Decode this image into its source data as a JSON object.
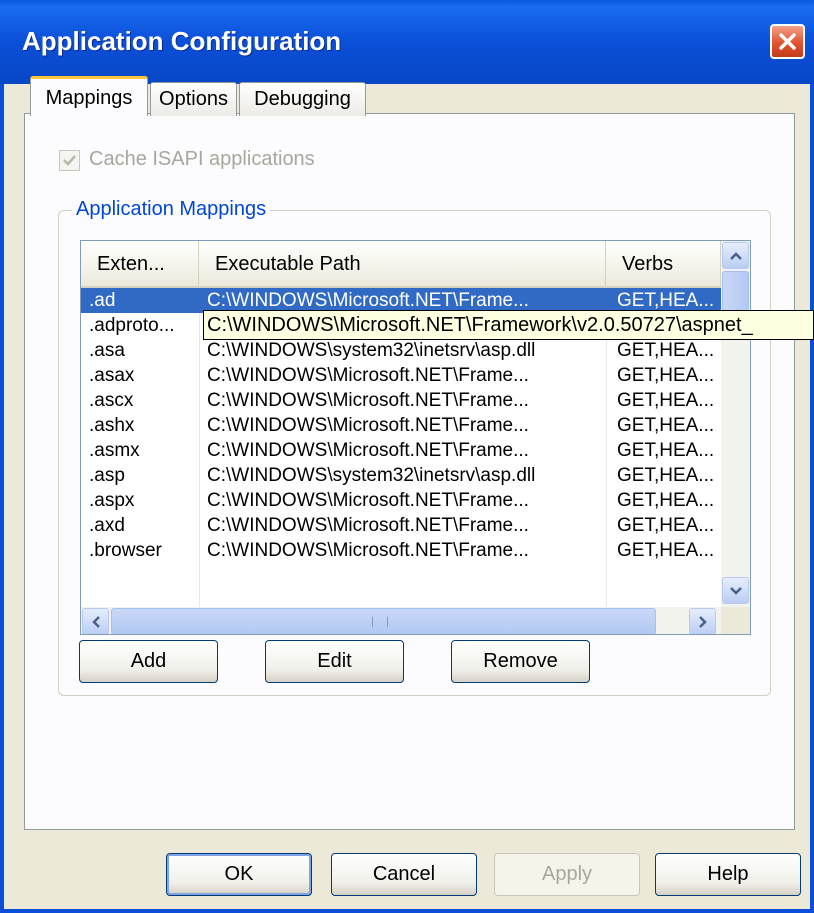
{
  "window": {
    "title": "Application Configuration",
    "close_icon": "close-icon"
  },
  "tabs": [
    {
      "label": "Mappings",
      "active": true
    },
    {
      "label": "Options",
      "active": false
    },
    {
      "label": "Debugging",
      "active": false
    }
  ],
  "cache_isapi": {
    "label": "Cache ISAPI applications",
    "checked": true,
    "disabled": true
  },
  "group": {
    "title": "Application Mappings"
  },
  "list": {
    "columns": [
      "Exten...",
      "Executable Path",
      "Verbs"
    ],
    "rows": [
      {
        "ext": ".ad",
        "path": "C:\\WINDOWS\\Microsoft.NET\\Frame...",
        "verbs": "GET,HEA...",
        "selected": true
      },
      {
        "ext": ".adproto...",
        "path": "",
        "verbs": "",
        "selected": false
      },
      {
        "ext": ".asa",
        "path": "C:\\WINDOWS\\system32\\inetsrv\\asp.dll",
        "verbs": "GET,HEA...",
        "selected": false
      },
      {
        "ext": ".asax",
        "path": "C:\\WINDOWS\\Microsoft.NET\\Frame...",
        "verbs": "GET,HEA...",
        "selected": false
      },
      {
        "ext": ".ascx",
        "path": "C:\\WINDOWS\\Microsoft.NET\\Frame...",
        "verbs": "GET,HEA...",
        "selected": false
      },
      {
        "ext": ".ashx",
        "path": "C:\\WINDOWS\\Microsoft.NET\\Frame...",
        "verbs": "GET,HEA...",
        "selected": false
      },
      {
        "ext": ".asmx",
        "path": "C:\\WINDOWS\\Microsoft.NET\\Frame...",
        "verbs": "GET,HEA...",
        "selected": false
      },
      {
        "ext": ".asp",
        "path": "C:\\WINDOWS\\system32\\inetsrv\\asp.dll",
        "verbs": "GET,HEA...",
        "selected": false
      },
      {
        "ext": ".aspx",
        "path": "C:\\WINDOWS\\Microsoft.NET\\Frame...",
        "verbs": "GET,HEA...",
        "selected": false
      },
      {
        "ext": ".axd",
        "path": "C:\\WINDOWS\\Microsoft.NET\\Frame...",
        "verbs": "GET,HEA...",
        "selected": false
      },
      {
        "ext": ".browser",
        "path": "C:\\WINDOWS\\Microsoft.NET\\Frame...",
        "verbs": "GET,HEA...",
        "selected": false
      }
    ],
    "tooltip": "C:\\WINDOWS\\Microsoft.NET\\Framework\\v2.0.50727\\aspnet_"
  },
  "mapping_buttons": {
    "add": "Add",
    "edit": "Edit",
    "remove": "Remove"
  },
  "dialog_buttons": {
    "ok": "OK",
    "cancel": "Cancel",
    "apply": "Apply",
    "help": "Help"
  },
  "colors": {
    "title_bar": "#0b4fd8",
    "selection": "#316ac5",
    "tab_highlight": "#ffc83c",
    "tooltip_bg": "#ffffe1"
  },
  "icons": {
    "scroll_up": "chevron-up-icon",
    "scroll_down": "chevron-down-icon",
    "scroll_left": "chevron-left-icon",
    "scroll_right": "chevron-right-icon",
    "checkmark": "checkmark-icon"
  }
}
